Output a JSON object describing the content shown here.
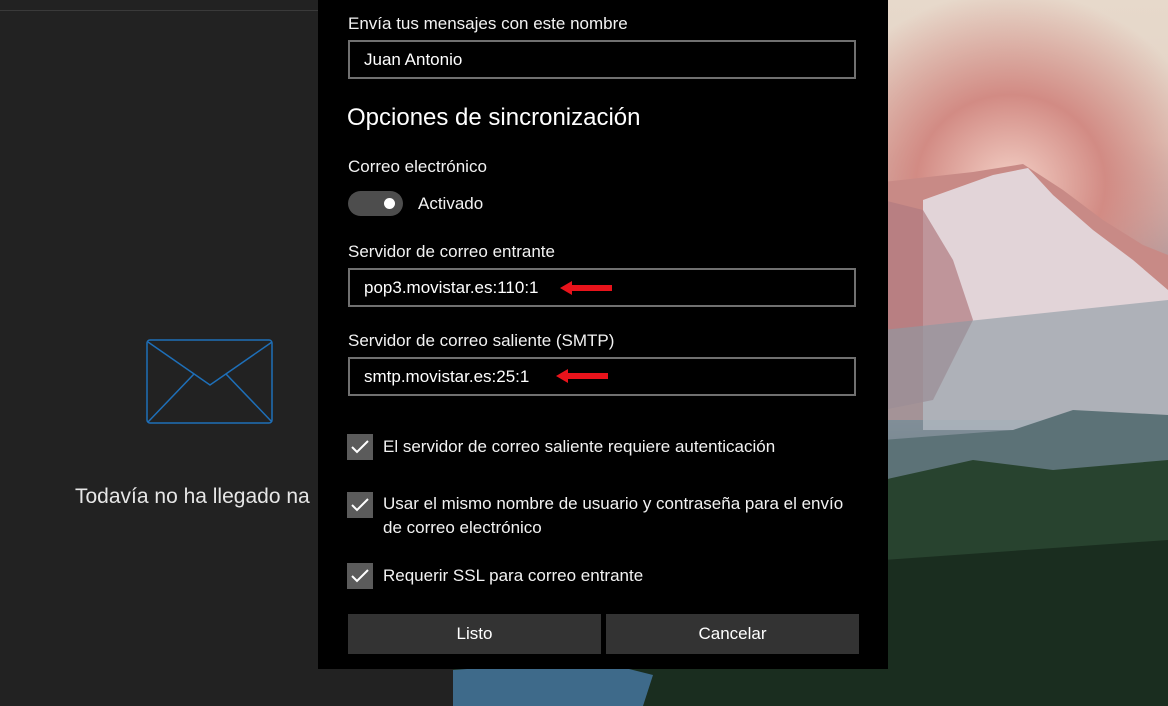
{
  "mail_pane": {
    "empty_message": "Todavía no ha llegado na"
  },
  "dialog": {
    "send_name_label": "Envía tus mensajes con este nombre",
    "send_name_value": "Juan Antonio",
    "sync_title": "Opciones de sincronización",
    "email_label": "Correo electrónico",
    "email_toggle_state": "Activado",
    "email_toggle_on": true,
    "incoming_label": "Servidor de correo entrante",
    "incoming_value": "pop3.movistar.es:110:1",
    "outgoing_label": "Servidor de correo saliente (SMTP)",
    "outgoing_value": "smtp.movistar.es:25:1",
    "checkboxes": [
      {
        "label": "El servidor de correo saliente requiere autenticación",
        "checked": true
      },
      {
        "label": "Usar el mismo nombre de usuario y contraseña para el envío de correo electrónico",
        "checked": true
      },
      {
        "label": "Requerir SSL para correo entrante",
        "checked": true
      }
    ],
    "done_button": "Listo",
    "cancel_button": "Cancelar"
  },
  "colors": {
    "envelope": "#1e6fb8",
    "annotation_arrow": "#e8131b",
    "dialog_background": "#000000"
  },
  "icons": [
    "envelope-icon",
    "red-arrow-icon",
    "checkmark-icon"
  ]
}
